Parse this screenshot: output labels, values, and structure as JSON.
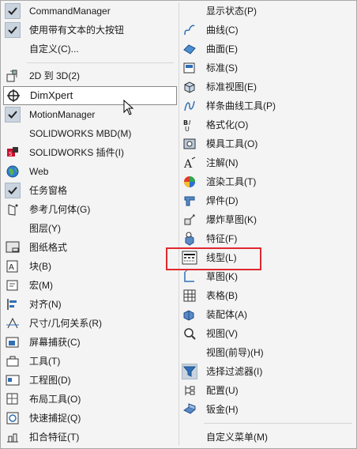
{
  "left_menu": [
    {
      "label": "CommandManager",
      "icon": "check-icon",
      "checked": true
    },
    {
      "label": "使用带有文本的大按钮",
      "icon": "check-icon",
      "checked": true
    },
    {
      "label": "自定义(C)...",
      "icon": ""
    },
    {
      "label": "2D 到 3D(2)",
      "icon": "2d-to-3d-icon"
    },
    {
      "label": "DimXpert",
      "icon": "dimxpert-icon"
    },
    {
      "label": "MotionManager",
      "icon": "check-icon",
      "checked": true
    },
    {
      "label": "SOLIDWORKS MBD(M)",
      "icon": ""
    },
    {
      "label": "SOLIDWORKS 插件(I)",
      "icon": "plugin-icon"
    },
    {
      "label": "Web",
      "icon": "globe-icon"
    },
    {
      "label": "任务窗格",
      "icon": "check-icon",
      "checked": true
    },
    {
      "label": "参考几何体(G)",
      "icon": "reference-geometry-icon"
    },
    {
      "label": "图层(Y)",
      "icon": ""
    },
    {
      "label": "图纸格式",
      "icon": "sheet-format-icon"
    },
    {
      "label": "块(B)",
      "icon": "block-icon"
    },
    {
      "label": "宏(M)",
      "icon": "macro-icon"
    },
    {
      "label": "对齐(N)",
      "icon": "align-icon"
    },
    {
      "label": "尺寸/几何关系(R)",
      "icon": "dimension-icon"
    },
    {
      "label": "屏幕捕获(C)",
      "icon": "screen-capture-icon"
    },
    {
      "label": "工具(T)",
      "icon": "toolbox-icon"
    },
    {
      "label": "工程图(D)",
      "icon": "drawing-icon"
    },
    {
      "label": "布局工具(O)",
      "icon": "layout-icon"
    },
    {
      "label": "快速捕捉(Q)",
      "icon": "quick-snap-icon"
    },
    {
      "label": "扣合特征(T)",
      "icon": "fastening-icon"
    }
  ],
  "right_menu": [
    {
      "label": "显示状态(P)",
      "icon": ""
    },
    {
      "label": "曲线(C)",
      "icon": "curve-icon"
    },
    {
      "label": "曲面(E)",
      "icon": "surface-icon"
    },
    {
      "label": "标准(S)",
      "icon": "standard-icon"
    },
    {
      "label": "标准视图(E)",
      "icon": "standard-views-icon"
    },
    {
      "label": "样条曲线工具(P)",
      "icon": "spline-icon"
    },
    {
      "label": "格式化(O)",
      "icon": "format-icon"
    },
    {
      "label": "模具工具(O)",
      "icon": "mold-icon"
    },
    {
      "label": "注解(N)",
      "icon": "annotation-icon"
    },
    {
      "label": "渲染工具(T)",
      "icon": "render-icon"
    },
    {
      "label": "焊件(D)",
      "icon": "weldment-icon"
    },
    {
      "label": "爆炸草图(K)",
      "icon": "explode-icon"
    },
    {
      "label": "特征(F)",
      "icon": "features-icon"
    },
    {
      "label": "线型(L)",
      "icon": "line-format-icon"
    },
    {
      "label": "草图(K)",
      "icon": "sketch-icon"
    },
    {
      "label": "表格(B)",
      "icon": "table-icon"
    },
    {
      "label": "装配体(A)",
      "icon": "assembly-icon"
    },
    {
      "label": "视图(V)",
      "icon": "view-icon"
    },
    {
      "label": "视图(前导)(H)",
      "icon": ""
    },
    {
      "label": "选择过滤器(I)",
      "icon": "selection-filter-icon"
    },
    {
      "label": "配置(U)",
      "icon": "configuration-icon"
    },
    {
      "label": "钣金(H)",
      "icon": "sheet-metal-icon"
    },
    {
      "label": "自定义菜单(M)",
      "icon": ""
    }
  ],
  "highlight_color": "#e0282e"
}
